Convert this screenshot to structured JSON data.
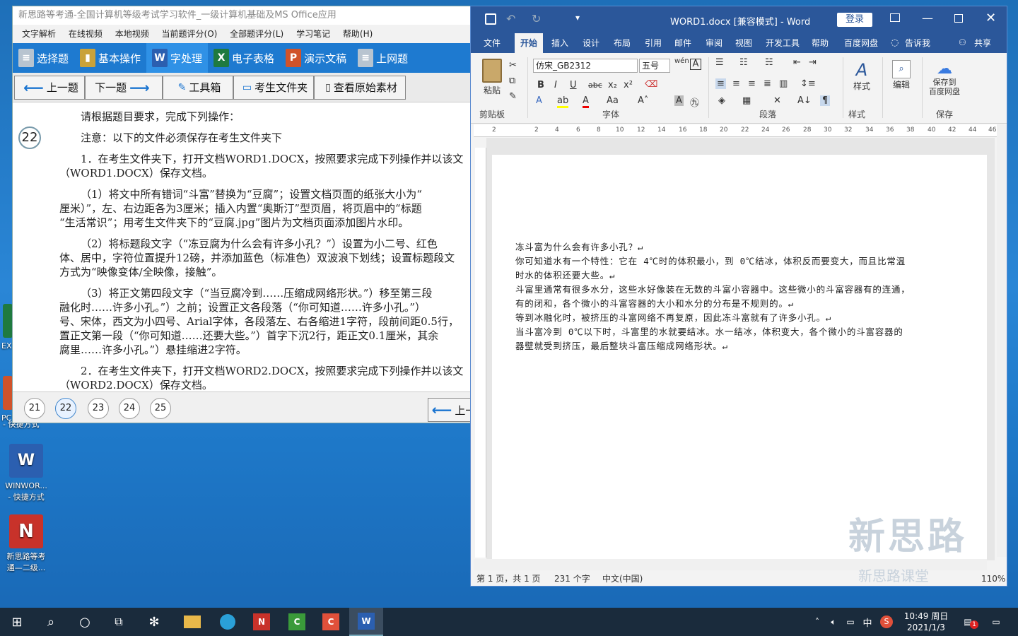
{
  "desktop": {
    "icons": [
      {
        "label": "EX"
      },
      {
        "label": "PC"
      },
      {
        "label": "WINWOR...\n- 快捷方式"
      },
      {
        "label": "新思路等考\n通—二级..."
      }
    ],
    "partial_label": "- 快捷方式"
  },
  "exam_app": {
    "title": "新思路等考通-全国计算机等级考试学习软件_一级计算机基础及MS Office应用",
    "menu": [
      "文字解析",
      "在线视频",
      "本地视频",
      "当前题评分(O)",
      "全部题评分(L)",
      "学习笔记",
      "帮助(H)"
    ],
    "categories": [
      {
        "label": "选择题",
        "icon": "list-icon",
        "color": "#9ab"
      },
      {
        "label": "基本操作",
        "icon": "folder-icon",
        "color": "#c9a23a"
      },
      {
        "label": "字处理",
        "icon": "word-icon",
        "color": "#2b5fb0"
      },
      {
        "label": "电子表格",
        "icon": "excel-icon",
        "color": "#1f7a3f"
      },
      {
        "label": "演示文稿",
        "icon": "powerpoint-icon",
        "color": "#d0532b"
      },
      {
        "label": "上网题",
        "icon": "web-icon",
        "color": "#9ab"
      }
    ],
    "nav_buttons": {
      "prev": "上一题",
      "next": "下一题",
      "toolbox": "工具箱",
      "exam_folder": "考生文件夹",
      "view_material": "查看原始素材"
    },
    "question_number": "22",
    "question_lines": [
      "请根据题目要求，完成下列操作：",
      "注意：以下的文件必须保存在考生文件夹下",
      "1．在考生文件夹下，打开文档WORD1.DOCX，按照要求完成下列操作并以该文",
      "（WORD1.DOCX）保存文档。",
      "（1）将文中所有错词“斗富”替换为“豆腐”；设置文档页面的纸张大小为“",
      "厘米）”，左、右边距各为3厘米；插入内置“奥斯汀”型页眉，将页眉中的“标题",
      "“生活常识”；用考生文件夹下的“豆腐.jpg”图片为文档页面添加图片水印。",
      "（2）将标题段文字（“冻豆腐为什么会有许多小孔？”）设置为小二号、红色",
      "体、居中，字符位置提升12磅，并添加蓝色（标准色）双波浪下划线；设置标题段文",
      "方式为“映像变体/全映像，接触”。",
      "（3）将正文第四段文字（“当豆腐冷到……压缩成网络形状。”）移至第三段",
      "融化时……许多小孔。”）之前；设置正文各段落（“你可知道……许多小孔。”）",
      "号、宋体，西文为小四号、Arial字体，各段落左、右各缩进1字符，段前间距0.5行，",
      "置正文第一段（“你可知道……还要大些。”）首字下沉2行，距正文0.1厘米，其余",
      "腐里……许多小孔。”）悬挂缩进2字符。",
      "2．在考生文件夹下，打开文档WORD2.DOCX，按照要求完成下列操作并以该文",
      "（WORD2.DOCX）保存文档。"
    ],
    "pager": [
      "21",
      "22",
      "23",
      "24",
      "25"
    ],
    "pager_active": "22",
    "pager_prev": "上一"
  },
  "word": {
    "title": "WORD1.docx [兼容模式] - Word",
    "login": "登录",
    "tabs": [
      "文件",
      "开始",
      "插入",
      "设计",
      "布局",
      "引用",
      "邮件",
      "审阅",
      "视图",
      "开发工具",
      "帮助",
      "百度网盘",
      "告诉我",
      "共享"
    ],
    "active_tab": "开始",
    "ribbon": {
      "paste": "粘贴",
      "clipboard": "剪贴板",
      "font_name": "仿宋_GB2312",
      "font_size": "五号",
      "font_group": "字体",
      "paragraph_group": "段落",
      "styles_btn": "样式",
      "styles_group": "样式",
      "edit_btn": "编辑",
      "save_baidu": "保存到\n百度网盘",
      "save_group": "保存"
    },
    "ruler_marks": [
      "2",
      "2",
      "4",
      "6",
      "8",
      "10",
      "12",
      "14",
      "16",
      "18",
      "20",
      "22",
      "24",
      "26",
      "28",
      "30",
      "32",
      "34",
      "36",
      "38",
      "40",
      "42",
      "44",
      "46"
    ],
    "document_lines": [
      "冻斗富为什么会有许多小孔？↵",
      "你可知道水有一个特性：它在 4℃时的体积最小，到 0℃结冰，体积反而要变大，而且比常温",
      "时水的体积还要大些。↵",
      "斗富里通常有很多水分，这些水好像装在无数的斗富小容器中。这些微小的斗富容器有的连通，",
      "有的闭和，各个微小的斗富容器的大小和水分的分布是不规则的。↵",
      "等到冰融化时，被挤压的斗富网络不再复原，因此冻斗富就有了许多小孔。↵",
      "当斗富冷到 0℃以下时，斗富里的水就要结冰。水一结冰，体积变大，各个微小的斗富容器的",
      "器壁就受到挤压，最后整块斗富压缩成网络形状。↵"
    ],
    "status": {
      "page": "第 1 页，共 1 页",
      "words": "231 个字",
      "lang": "中文(中国)",
      "zoom": "110%"
    }
  },
  "watermark": {
    "text": "新思路",
    "subtext": "新思路课堂"
  },
  "taskbar": {
    "time": "10:49 周日",
    "date": "2021/1/3",
    "ime": "中",
    "notification_count": "1"
  }
}
